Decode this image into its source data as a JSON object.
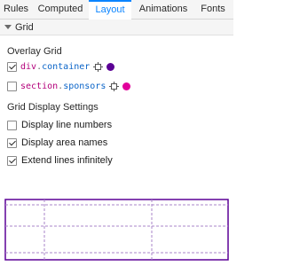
{
  "tabs": [
    {
      "label": "Rules",
      "active": false
    },
    {
      "label": "Computed",
      "active": false
    },
    {
      "label": "Layout",
      "active": true
    },
    {
      "label": "Animations",
      "active": false
    },
    {
      "label": "Fonts",
      "active": false
    }
  ],
  "section": {
    "title": "Grid"
  },
  "overlay": {
    "heading": "Overlay Grid",
    "items": [
      {
        "tag": "div",
        "dot": ".",
        "cls": "container",
        "checked": true,
        "color": "#5b0095"
      },
      {
        "tag": "section",
        "dot": ".",
        "cls": "sponsors",
        "checked": false,
        "color": "#e1009b"
      }
    ]
  },
  "display": {
    "heading": "Grid Display Settings",
    "options": [
      {
        "label": "Display line numbers",
        "checked": false
      },
      {
        "label": "Display area names",
        "checked": true
      },
      {
        "label": "Extend lines infinitely",
        "checked": true
      }
    ]
  },
  "colors": {
    "accent": "#0a84ff",
    "grid_outline": "#5b0095",
    "grid_inner": "#a884c8"
  }
}
